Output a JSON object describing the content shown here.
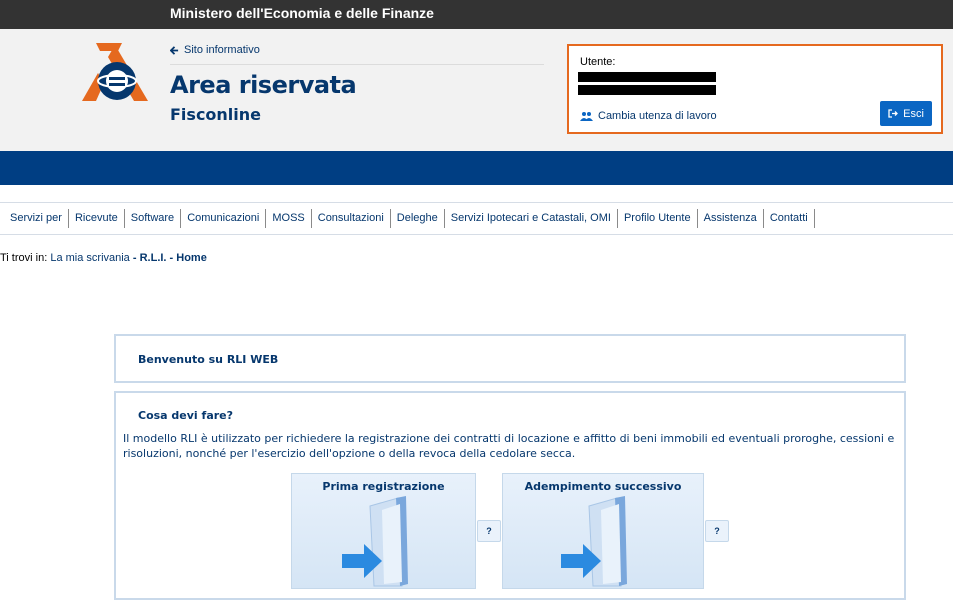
{
  "topbar": {
    "ministry": "Ministero dell'Economia e delle Finanze"
  },
  "header": {
    "back_link": "Sito informativo",
    "title": "Area riservata",
    "subtitle": "Fisconline"
  },
  "user_box": {
    "label": "Utente:",
    "change_link": "Cambia utenza di lavoro",
    "logout": "Esci"
  },
  "menu": {
    "items": [
      "Servizi per",
      "Ricevute",
      "Software",
      "Comunicazioni",
      "MOSS",
      "Consultazioni",
      "Deleghe",
      "Servizi Ipotecari e Catastali, OMI",
      "Profilo Utente",
      "Assistenza",
      "Contatti"
    ]
  },
  "breadcrumb": {
    "prefix": "Ti trovi in: ",
    "link1": "La mia scrivania",
    "sep1": " - ",
    "link2": "R.L.I.",
    "sep2": " - ",
    "current": "Home"
  },
  "welcome": {
    "title": "Benvenuto su RLI WEB"
  },
  "cosa": {
    "title": "Cosa devi fare?",
    "description": "Il modello RLI è utilizzato per richiedere la registrazione dei contratti di locazione e affitto di beni immobili ed eventuali proroghe, cessioni e risoluzioni, nonché per l'esercizio dell'opzione o della revoca della cedolare secca.",
    "actions": [
      {
        "label": "Prima registrazione"
      },
      {
        "label": "Adempimento successivo"
      }
    ],
    "help": "?"
  },
  "colors": {
    "brand_blue": "#003e83",
    "accent_orange": "#e5691f",
    "button_blue": "#0b66c3"
  }
}
